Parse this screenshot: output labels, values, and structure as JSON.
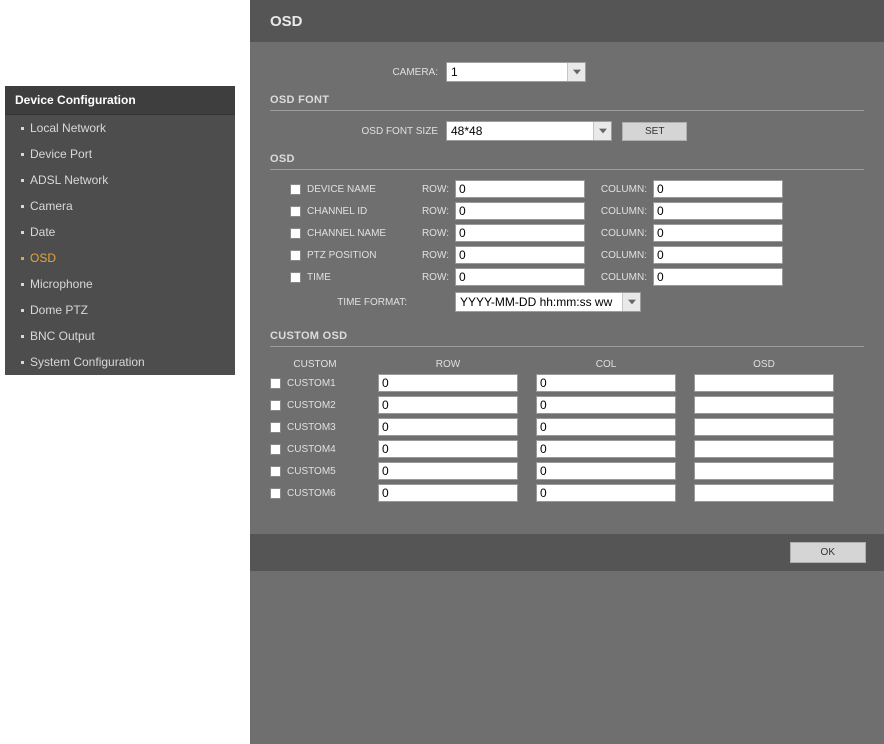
{
  "sidebar": {
    "header": "Device Configuration",
    "items": [
      {
        "label": "Local Network"
      },
      {
        "label": "Device Port"
      },
      {
        "label": "ADSL Network"
      },
      {
        "label": "Camera"
      },
      {
        "label": "Date"
      },
      {
        "label": "OSD"
      },
      {
        "label": "Microphone"
      },
      {
        "label": "Dome PTZ"
      },
      {
        "label": "BNC Output"
      },
      {
        "label": "System Configuration"
      }
    ],
    "active_index": 5
  },
  "title": "OSD",
  "camera": {
    "label": "CAMERA:",
    "value": "1"
  },
  "font_section": {
    "heading": "OSD FONT",
    "size_label": "OSD FONT SIZE",
    "size_value": "48*48",
    "set_label": "SET"
  },
  "osd_section": {
    "heading": "OSD",
    "row_label": "ROW:",
    "column_label": "COLUMN:",
    "items": [
      {
        "name": "DEVICE NAME",
        "row": "0",
        "col": "0"
      },
      {
        "name": "CHANNEL ID",
        "row": "0",
        "col": "0"
      },
      {
        "name": "CHANNEL NAME",
        "row": "0",
        "col": "0"
      },
      {
        "name": "PTZ POSITION",
        "row": "0",
        "col": "0"
      },
      {
        "name": "TIME",
        "row": "0",
        "col": "0"
      }
    ],
    "time_format_label": "TIME FORMAT:",
    "time_format_value": "YYYY-MM-DD hh:mm:ss ww"
  },
  "custom_section": {
    "heading": "CUSTOM OSD",
    "cols": {
      "custom": "CUSTOM",
      "row": "ROW",
      "col": "COL",
      "osd": "OSD"
    },
    "rows": [
      {
        "name": "CUSTOM1",
        "row": "0",
        "col": "0",
        "osd": ""
      },
      {
        "name": "CUSTOM2",
        "row": "0",
        "col": "0",
        "osd": ""
      },
      {
        "name": "CUSTOM3",
        "row": "0",
        "col": "0",
        "osd": ""
      },
      {
        "name": "CUSTOM4",
        "row": "0",
        "col": "0",
        "osd": ""
      },
      {
        "name": "CUSTOM5",
        "row": "0",
        "col": "0",
        "osd": ""
      },
      {
        "name": "CUSTOM6",
        "row": "0",
        "col": "0",
        "osd": ""
      }
    ]
  },
  "footer": {
    "ok": "OK"
  }
}
